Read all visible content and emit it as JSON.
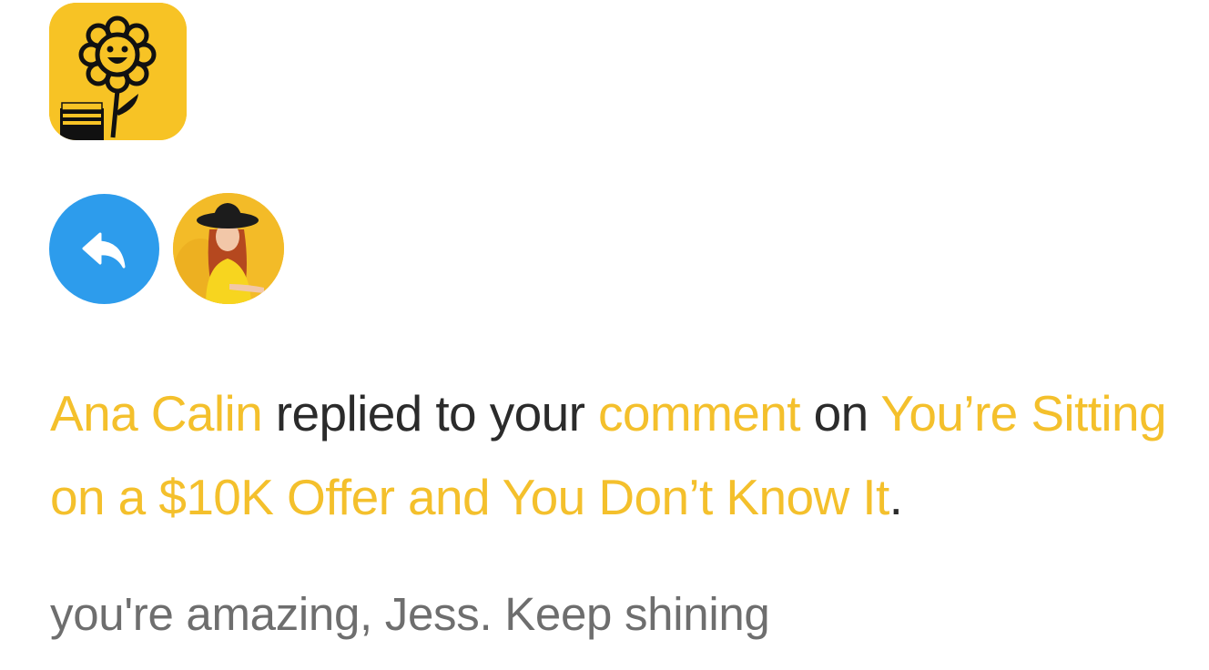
{
  "notification": {
    "actor_name": "Ana Calin",
    "action_text": " replied to your ",
    "target_label": "comment",
    "on_text": " on ",
    "story_title": "You’re Sitting on a $10K Offer and You Don’t Know It",
    "end_punct": ".",
    "snippet": "you're amazing, Jess. Keep shining"
  },
  "icons": {
    "app": "sunflower-app-icon",
    "reply": "reply-arrow-icon",
    "avatar": "user-avatar"
  },
  "colors": {
    "highlight": "#f4c02c",
    "text": "#2b2b2b",
    "muted": "#6e6e6e",
    "reply_badge": "#2d9cec",
    "app_bg": "#f7c325"
  }
}
